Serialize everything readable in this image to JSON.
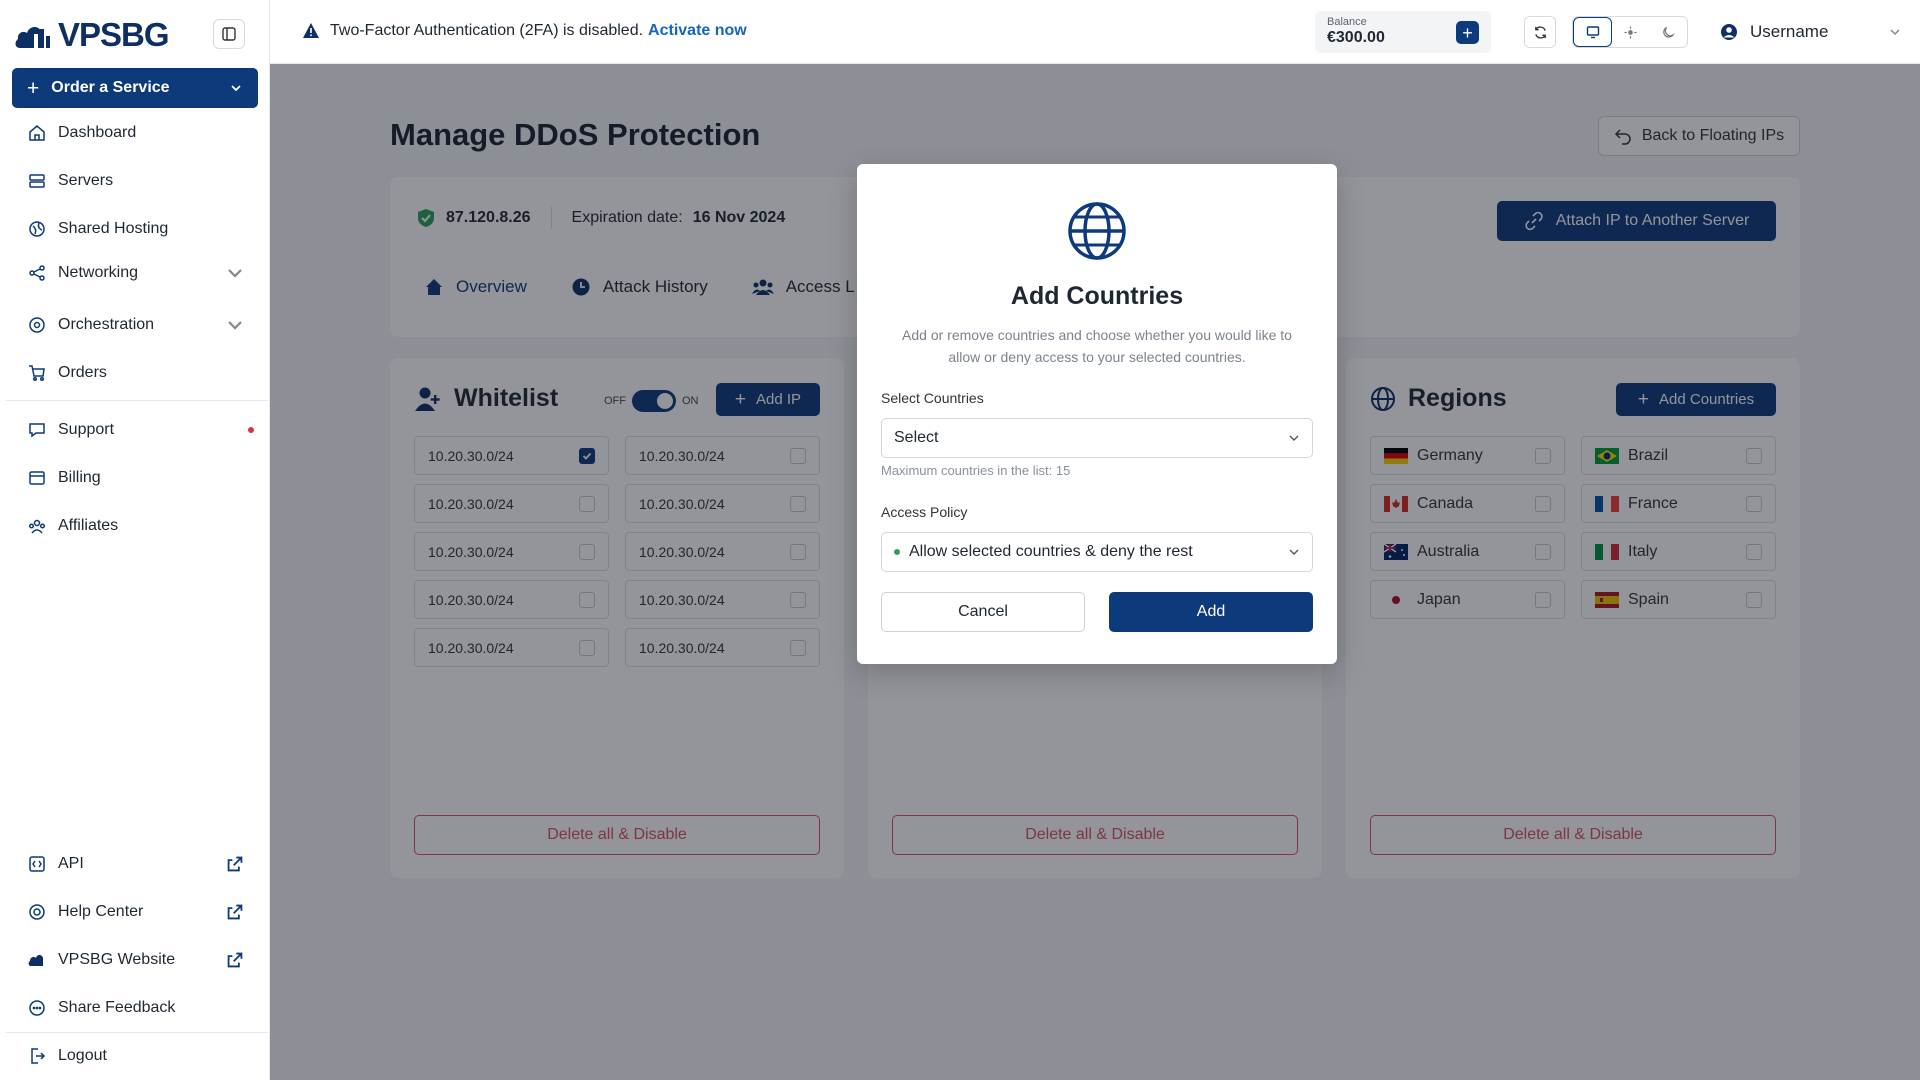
{
  "brand": {
    "name": "VPSBG"
  },
  "sidebar": {
    "order_label": "Order a Service",
    "items": [
      {
        "label": "Dashboard",
        "icon": "home-icon"
      },
      {
        "label": "Servers",
        "icon": "server-icon"
      },
      {
        "label": "Shared Hosting",
        "icon": "hosting-icon"
      },
      {
        "label": "Networking",
        "icon": "network-icon"
      },
      {
        "label": "Orchestration",
        "icon": "orchestration-icon"
      },
      {
        "label": "Orders",
        "icon": "cart-icon"
      },
      {
        "label": "Support",
        "icon": "support-icon"
      },
      {
        "label": "Billing",
        "icon": "billing-icon"
      },
      {
        "label": "Affiliates",
        "icon": "affiliates-icon"
      }
    ],
    "bottom": [
      {
        "label": "API",
        "icon": "api-icon"
      },
      {
        "label": "Help Center",
        "icon": "help-icon"
      },
      {
        "label": "VPSBG Website",
        "icon": "vpsbg-icon"
      },
      {
        "label": "Share Feedback",
        "icon": "feedback-icon"
      },
      {
        "label": "Logout",
        "icon": "logout-icon"
      }
    ]
  },
  "topbar": {
    "alert_text": "Two-Factor Authentication (2FA) is disabled.",
    "alert_link": "Activate now",
    "balance_label": "Balance",
    "balance_value": "€300.00",
    "username": "Username"
  },
  "page": {
    "title": "Manage DDoS Protection",
    "back_label": "Back to Floating IPs",
    "ip": "87.120.8.26",
    "expiration_label": "Expiration date:",
    "expiration_value": "16 Nov 2024",
    "attach_label": "Attach IP to Another Server",
    "tabs": [
      "Overview",
      "Attack History",
      "Access L"
    ]
  },
  "whitelist": {
    "title": "Whitelist",
    "toggle_off": "OFF",
    "toggle_on": "ON",
    "add_label": "Add IP",
    "ips": [
      {
        "ip": "10.20.30.0/24",
        "checked": true
      },
      {
        "ip": "10.20.30.0/24",
        "checked": false
      },
      {
        "ip": "10.20.30.0/24",
        "checked": false
      },
      {
        "ip": "10.20.30.0/24",
        "checked": false
      },
      {
        "ip": "10.20.30.0/24",
        "checked": false
      },
      {
        "ip": "10.20.30.0/24",
        "checked": false
      },
      {
        "ip": "10.20.30.0/24",
        "checked": false
      },
      {
        "ip": "10.20.30.0/24",
        "checked": false
      },
      {
        "ip": "10.20.30.0/24",
        "checked": false
      },
      {
        "ip": "10.20.30.0/24",
        "checked": false
      }
    ],
    "delete_label": "Delete all & Disable"
  },
  "middle_panel": {
    "delete_label": "Delete all & Disable"
  },
  "regions": {
    "title": "Regions",
    "add_label": "Add Countries",
    "countries": [
      {
        "name": "Germany",
        "flag": "de"
      },
      {
        "name": "Brazil",
        "flag": "br"
      },
      {
        "name": "Canada",
        "flag": "ca"
      },
      {
        "name": "France",
        "flag": "fr"
      },
      {
        "name": "Australia",
        "flag": "au"
      },
      {
        "name": "Italy",
        "flag": "it"
      },
      {
        "name": "Japan",
        "flag": "jp"
      },
      {
        "name": "Spain",
        "flag": "es"
      }
    ],
    "delete_label": "Delete all & Disable"
  },
  "modal": {
    "title": "Add Countries",
    "description": "Add or remove countries and choose whether you would like to allow or deny access to your selected countries.",
    "select_label": "Select Countries",
    "select_placeholder": "Select",
    "hint": "Maximum countries in the list: 15",
    "policy_label": "Access Policy",
    "policy_value": "Allow selected countries & deny the rest",
    "cancel_label": "Cancel",
    "add_label": "Add"
  },
  "colors": {
    "primary": "#0d3a7a",
    "danger": "#d9535f",
    "link": "#1565c0",
    "status_green": "#2e9d5b"
  }
}
